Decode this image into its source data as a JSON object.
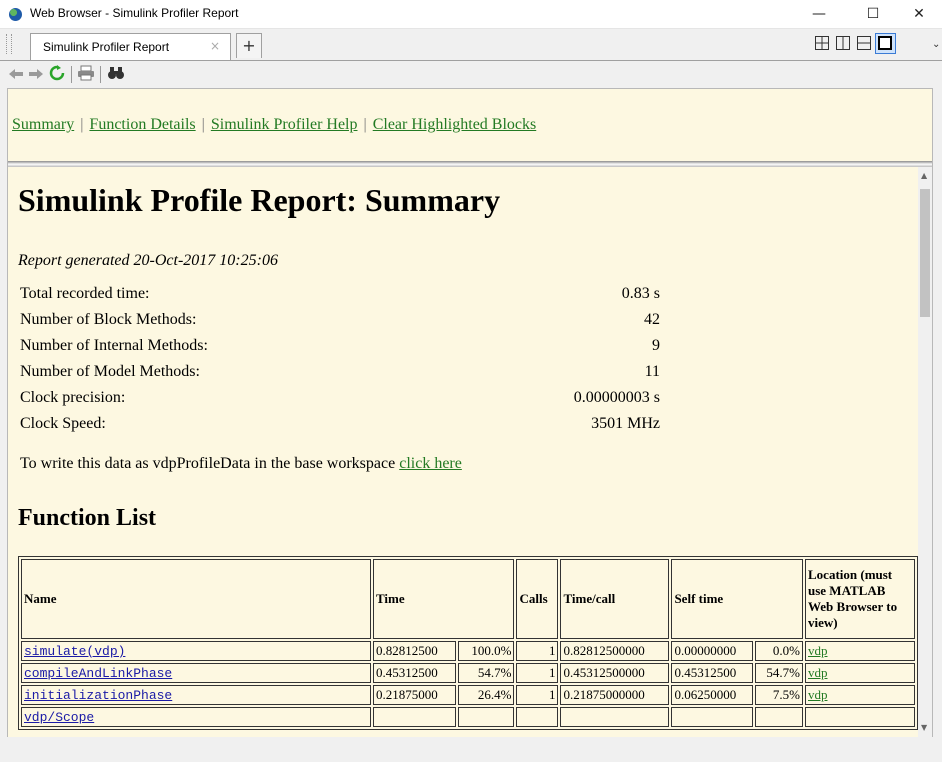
{
  "window": {
    "title": "Web Browser - Simulink Profiler Report"
  },
  "tabs": [
    {
      "label": "Simulink Profiler Report",
      "close_glyph": "×"
    }
  ],
  "nav": {
    "links": [
      "Summary",
      "Function Details",
      "Simulink Profiler Help",
      "Clear Highlighted Blocks"
    ]
  },
  "report": {
    "title": "Simulink Profile Report: Summary",
    "generated": "Report generated 20-Oct-2017 10:25:06",
    "stats": [
      {
        "label": "Total recorded time:",
        "value": "0.83 s"
      },
      {
        "label": "Number of Block Methods:",
        "value": "42"
      },
      {
        "label": "Number of Internal Methods:",
        "value": "9"
      },
      {
        "label": "Number of Model Methods:",
        "value": "11"
      },
      {
        "label": "Clock precision:",
        "value": "0.00000003 s"
      },
      {
        "label": "Clock Speed:",
        "value": "3501 MHz"
      }
    ],
    "write_text": "To write this data as vdpProfileData in the base workspace",
    "write_link": "click here",
    "function_list_heading": "Function List",
    "table": {
      "headers": {
        "name": "Name",
        "time": "Time",
        "calls": "Calls",
        "time_per_call": "Time/call",
        "self_time": "Self time",
        "location": "Location (must use MATLAB Web Browser to view)"
      },
      "rows": [
        {
          "name": "simulate(vdp)",
          "time": "0.82812500",
          "time_pct": "100.0%",
          "calls": "1",
          "time_per_call": "0.82812500000",
          "self_time": "0.00000000",
          "self_pct": "0.0%",
          "location": "vdp"
        },
        {
          "name": "compileAndLinkPhase",
          "time": "0.45312500",
          "time_pct": "54.7%",
          "calls": "1",
          "time_per_call": "0.45312500000",
          "self_time": "0.45312500",
          "self_pct": "54.7%",
          "location": "vdp"
        },
        {
          "name": "initializationPhase",
          "time": "0.21875000",
          "time_pct": "26.4%",
          "calls": "1",
          "time_per_call": "0.21875000000",
          "self_time": "0.06250000",
          "self_pct": "7.5%",
          "location": "vdp"
        },
        {
          "name": "vdp/Scope",
          "time": "",
          "time_pct": "",
          "calls": "",
          "time_per_call": "",
          "self_time": "",
          "self_pct": "",
          "location": ""
        }
      ]
    }
  }
}
